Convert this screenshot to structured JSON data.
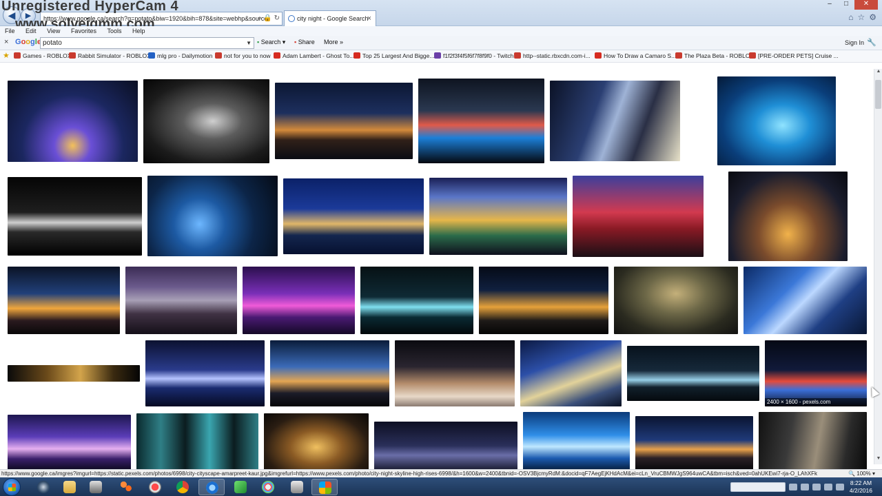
{
  "watermark": {
    "line1": "Unregistered HyperCam 4",
    "line2": "www.solveigmm.com"
  },
  "browser": {
    "address_url": "https://www.google.ca/search?q=potato&biw=1920&bih=878&site=webhp&source",
    "tab_title": "city night - Google Search"
  },
  "menubar": {
    "items": [
      "File",
      "Edit",
      "View",
      "Favorites",
      "Tools",
      "Help"
    ]
  },
  "google_toolbar": {
    "logo": "Google",
    "search_value": "potato",
    "search_label": "Search",
    "share_label": "Share",
    "more_label": "More »",
    "sign_in_label": "Sign In"
  },
  "favorites": [
    {
      "label": "Games - ROBLOX",
      "color": "#c93a2e"
    },
    {
      "label": "Rabbit Simulator - ROBLOX",
      "color": "#c93a2e"
    },
    {
      "label": "mlg pro - Dailymotion",
      "color": "#2361c4"
    },
    {
      "label": "not for you to now",
      "color": "#c93a2e"
    },
    {
      "label": "Adam Lambert - Ghost To...",
      "color": "#d62b20"
    },
    {
      "label": "Top 25 Largest And Bigge...",
      "color": "#d62b20"
    },
    {
      "label": "f1f2f3f4f5f6f7f8f9f0 - Twitch",
      "color": "#6b3fa8"
    },
    {
      "label": "http--static.rbxcdn.com-i...",
      "color": "#c93a2e"
    },
    {
      "label": "How To Draw a Camaro S...",
      "color": "#d62b20"
    },
    {
      "label": "The Plaza Beta - ROBLOX",
      "color": "#c93a2e"
    },
    {
      "label": "[PRE-ORDER PETS] Cruise ...",
      "color": "#c93a2e"
    }
  ],
  "hover_caption": "2400 × 1600 - pexels.com",
  "status": {
    "url": "https://www.google.ca/imgres?imgurl=https://static.pexels.com/photos/6998/city-cityscape-amarpreet-kaur.jpg&imgrefurl=https://www.pexels.com/photo/city-night-skyline-high-rises-6998/&h=1600&w=2400&tbnid=-OSV3BjcmyRdM:&docid=qF7AegEjKHdAcM&ei=cLn_VruCBMWJgS964uwCA&tbm=isch&ved=0ahUKEwi7-rja-O_LAhXFk",
    "zoom": "100%"
  },
  "clock": {
    "time": "8:22 AM",
    "date": "4/2/2016"
  }
}
